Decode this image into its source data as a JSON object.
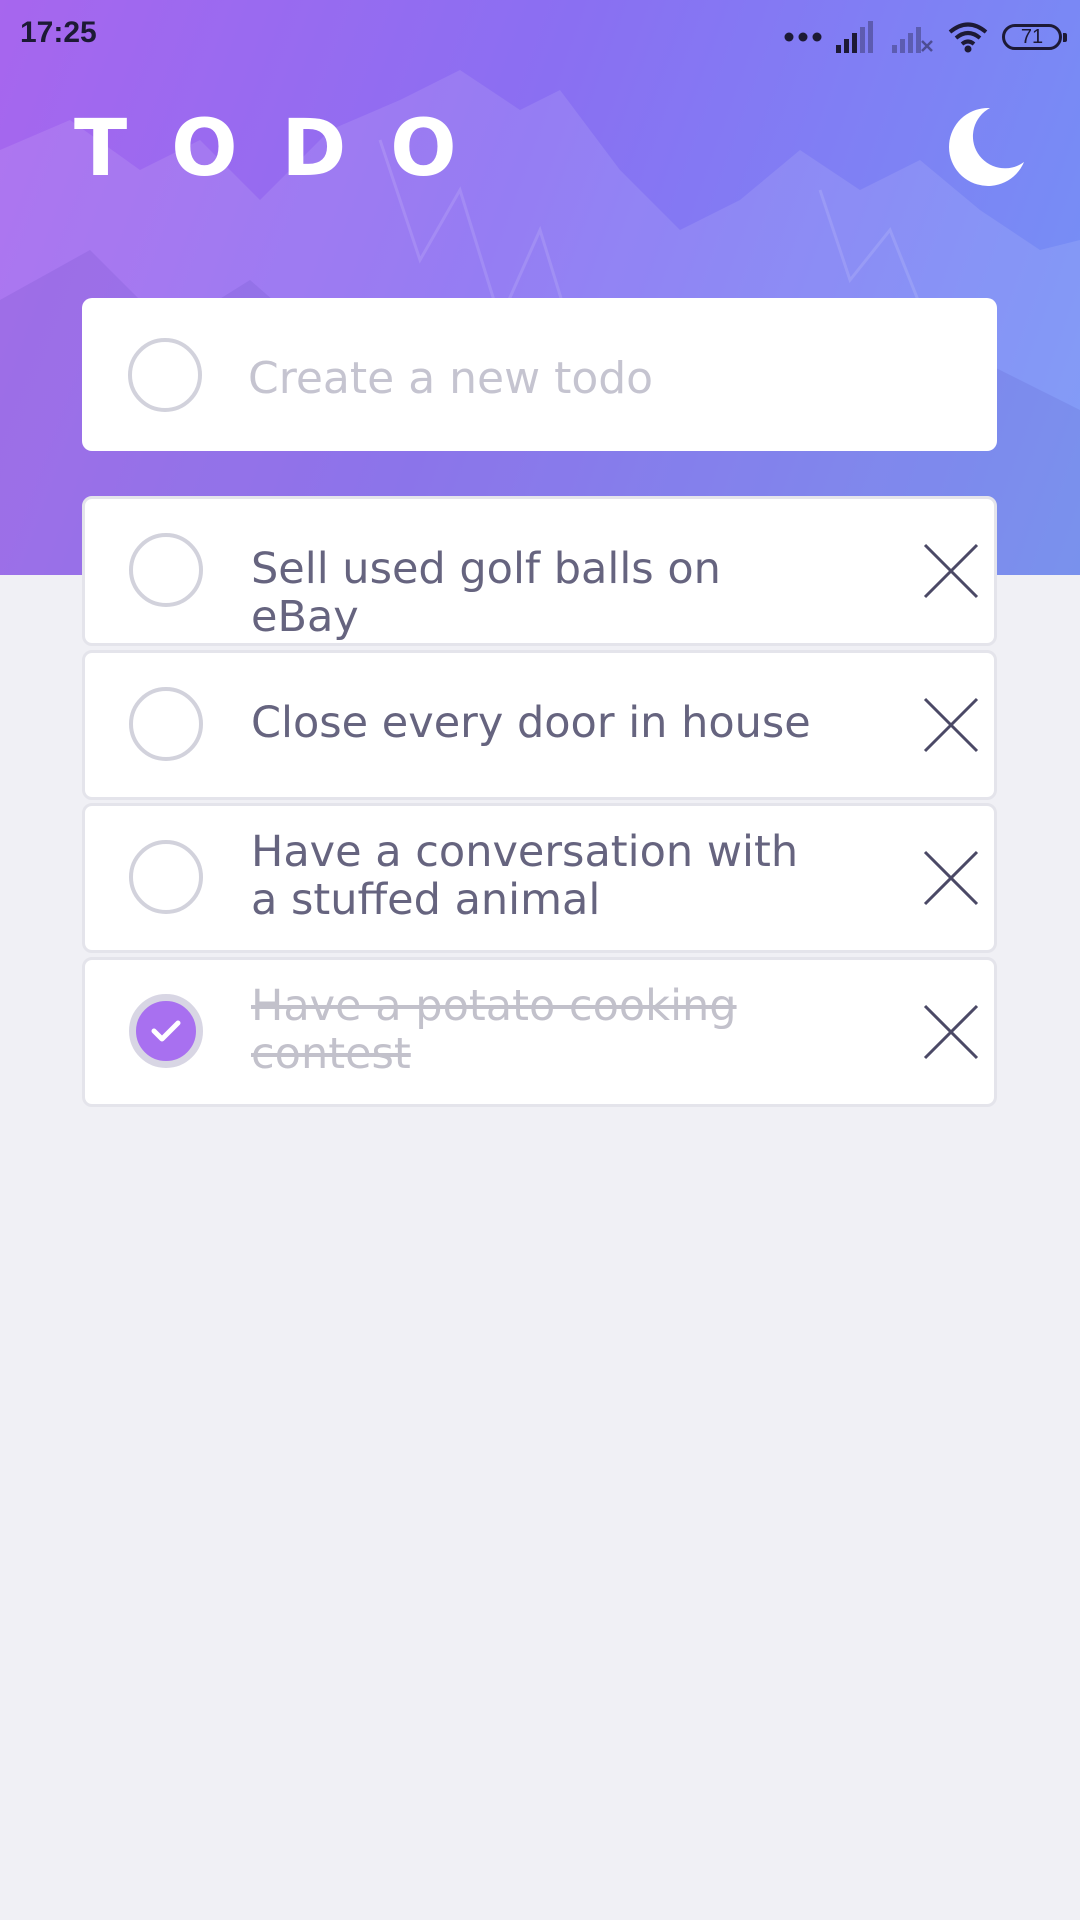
{
  "status_bar": {
    "time": "17:25",
    "battery_level": "71",
    "icons": [
      "more-dots-icon",
      "signal-icon",
      "signal-off-icon",
      "wifi-icon",
      "battery-icon"
    ]
  },
  "header": {
    "title": "TODO",
    "theme_toggle_icon": "moon-icon"
  },
  "new_todo": {
    "placeholder": "Create a new todo"
  },
  "todos": [
    {
      "text": "Sell used golf balls on eBay",
      "completed": false
    },
    {
      "text": "Close every door in house",
      "completed": false
    },
    {
      "text": "Have a conversation with a stuffed animal",
      "completed": false
    },
    {
      "text": "Have a potato cooking contest",
      "completed": true
    }
  ],
  "colors": {
    "accent": "#a870f0",
    "gradient_start": "#a766ee",
    "gradient_end": "#7393f6",
    "page_background": "#f0f0f5",
    "text": "#66647f",
    "completed_text": "#c2c1cb"
  }
}
